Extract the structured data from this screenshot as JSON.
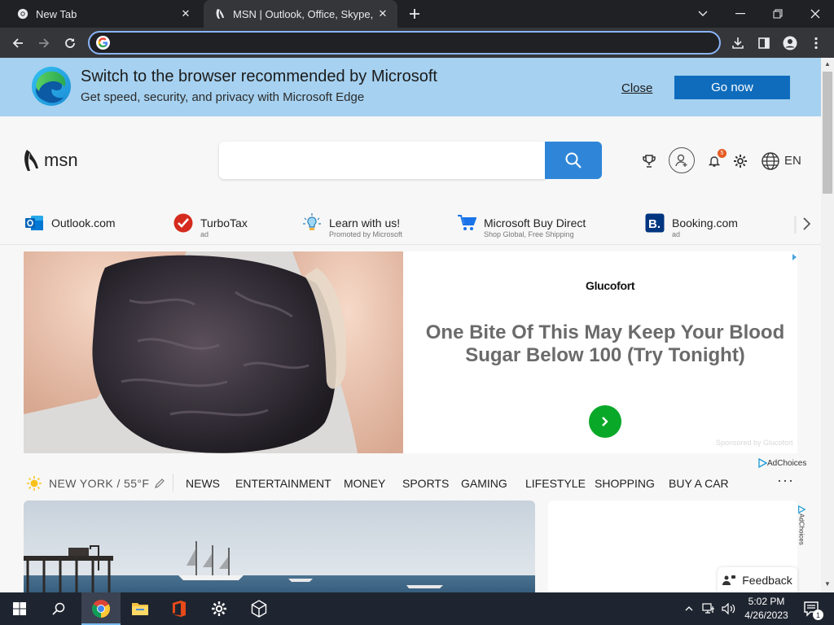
{
  "browser": {
    "tabs": [
      {
        "title": "New Tab",
        "active": false
      },
      {
        "title": "MSN | Outlook, Office, Skype, Bing",
        "active": true
      }
    ],
    "omnibox": {
      "value": "",
      "placeholder": ""
    }
  },
  "edge_banner": {
    "title": "Switch to the browser recommended by Microsoft",
    "subtitle": "Get speed, security, and privacy with Microsoft Edge",
    "close_label": "Close",
    "go_label": "Go now"
  },
  "msn": {
    "logo_text": "msn",
    "search": {
      "value": "",
      "placeholder": ""
    },
    "notification_count": "5",
    "language": "EN"
  },
  "quick_links": [
    {
      "name": "Outlook.com",
      "sub": "",
      "icon": "outlook-icon"
    },
    {
      "name": "TurboTax",
      "sub": "ad",
      "icon": "turbotax-icon"
    },
    {
      "name": "Learn with us!",
      "sub": "Promoted by Microsoft",
      "icon": "lightbulb-icon"
    },
    {
      "name": "Microsoft Buy Direct",
      "sub": "Shop Global, Free Shipping",
      "icon": "cart-icon"
    },
    {
      "name": "Booking.com",
      "sub": "ad",
      "icon": "booking-icon"
    }
  ],
  "ad": {
    "brand": "Glucofort",
    "headline": "One Bite Of This May Keep Your Blood Sugar Below 100 (Try Tonight)",
    "sponsor": "Sponsored by Glucofort",
    "adchoices": "AdChoices"
  },
  "nav": {
    "weather": "NEW YORK / 55°F",
    "items": [
      "NEWS",
      "ENTERTAINMENT",
      "MONEY",
      "SPORTS",
      "GAMING",
      "LIFESTYLE",
      "SHOPPING",
      "BUY A CAR"
    ],
    "more": "···"
  },
  "side": {
    "adchoices": "AdChoices",
    "feedback_label": "Feedback"
  },
  "taskbar": {
    "time": "5:02 PM",
    "date": "4/26/2023",
    "notification_count": "1"
  },
  "colors": {
    "banner_bg": "#a6d1f0",
    "go_button": "#0f6cbd",
    "search_button": "#2f86d8",
    "ad_cta": "#0aa829",
    "chrome_dark": "#202124"
  }
}
